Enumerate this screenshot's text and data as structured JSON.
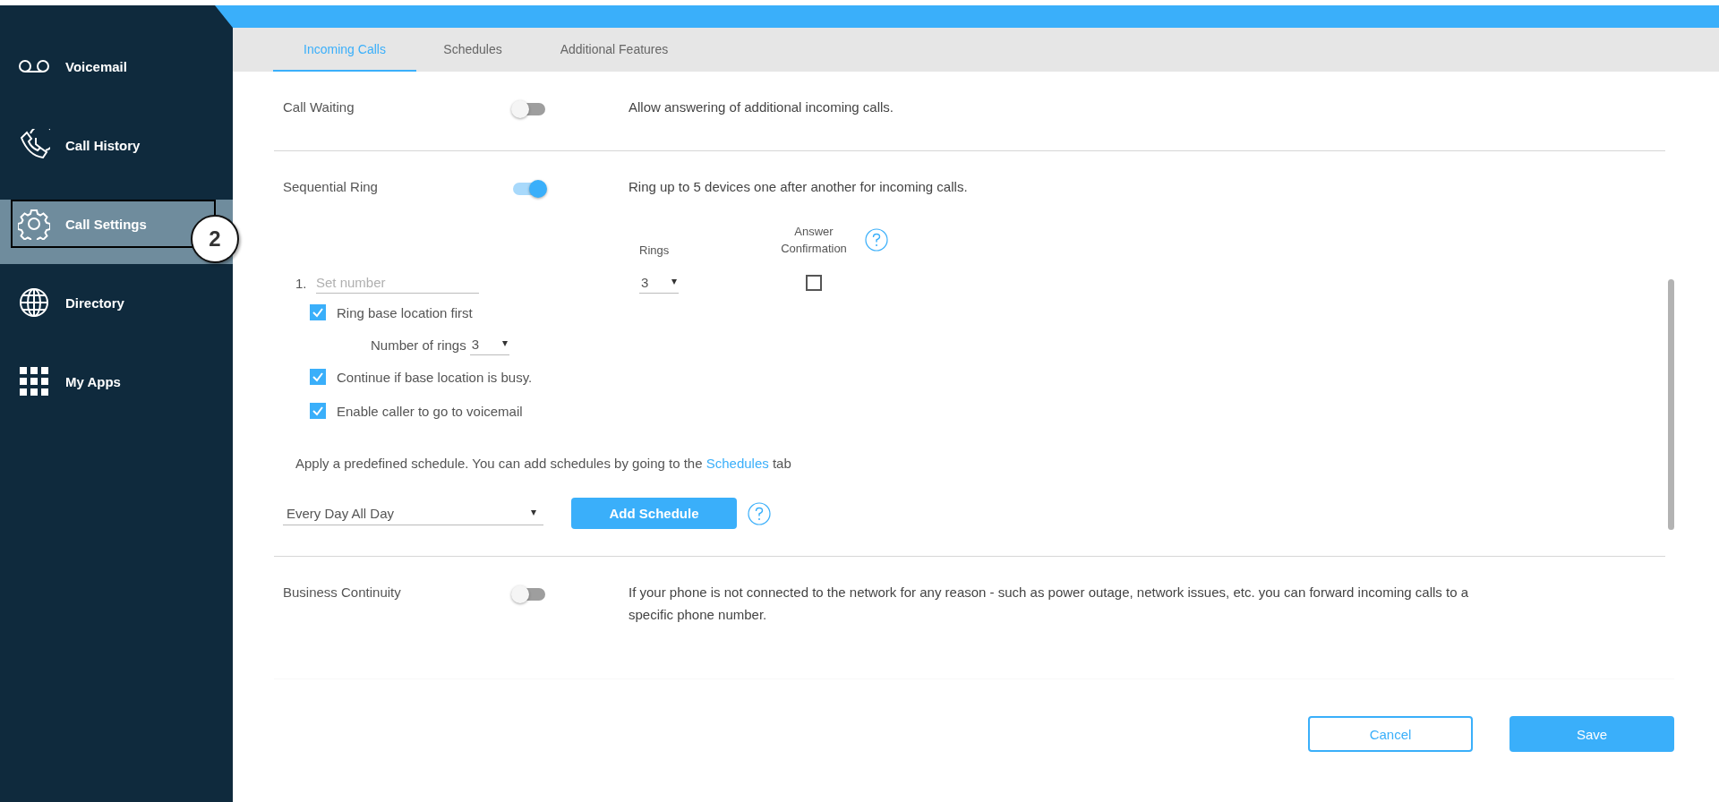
{
  "sidebar": {
    "items": [
      {
        "kind": "voicemail",
        "label": "Voicemail",
        "selected": false
      },
      {
        "kind": "history",
        "label": "Call History",
        "selected": false
      },
      {
        "kind": "settings",
        "label": "Call Settings",
        "selected": true
      },
      {
        "kind": "globe",
        "label": "Directory",
        "selected": false
      },
      {
        "kind": "apps",
        "label": "My Apps",
        "selected": false
      }
    ]
  },
  "callout": {
    "text": "2"
  },
  "tabs": [
    {
      "label": "Incoming Calls",
      "selected": true
    },
    {
      "label": "Schedules",
      "selected": false
    },
    {
      "label": "Additional Features",
      "selected": false
    }
  ],
  "settings": [
    {
      "label": "Call Waiting",
      "on": false,
      "description": "Allow answering of additional incoming calls."
    },
    {
      "label": "Sequential Ring",
      "on": true,
      "description": "Ring up to 5 devices one after another for incoming calls.",
      "details": {
        "rings_label": "Rings",
        "confirmation_label": "Answer Confirmation",
        "devices": [
          {
            "index": "1.",
            "placeholder": "Set number",
            "rings": "3",
            "answer_confirmation": false
          }
        ],
        "options": [
          {
            "kind": "checkbox",
            "label": "Ring base location first",
            "checked": true
          },
          {
            "kind": "select",
            "label": "Number of rings",
            "value": "3"
          },
          {
            "kind": "checkbox",
            "label": "Continue if base location is busy.",
            "checked": true
          },
          {
            "kind": "checkbox",
            "label": "Enable caller to go to voicemail",
            "checked": true
          }
        ],
        "schedule_note": {
          "before": "Apply a predefined schedule. You can add schedules by going to the",
          "link": "Schedules",
          "after": "tab"
        },
        "schedule": "Every Day All Day",
        "add_button": "Add Schedule"
      }
    },
    {
      "label": "Business Continuity",
      "on": false,
      "description": "If your phone is not connected to the network for any reason - such as power outage, network issues, etc. you can forward incoming calls to a specific phone number."
    }
  ],
  "buttons": {
    "cancel": "Cancel",
    "save": "Save"
  }
}
